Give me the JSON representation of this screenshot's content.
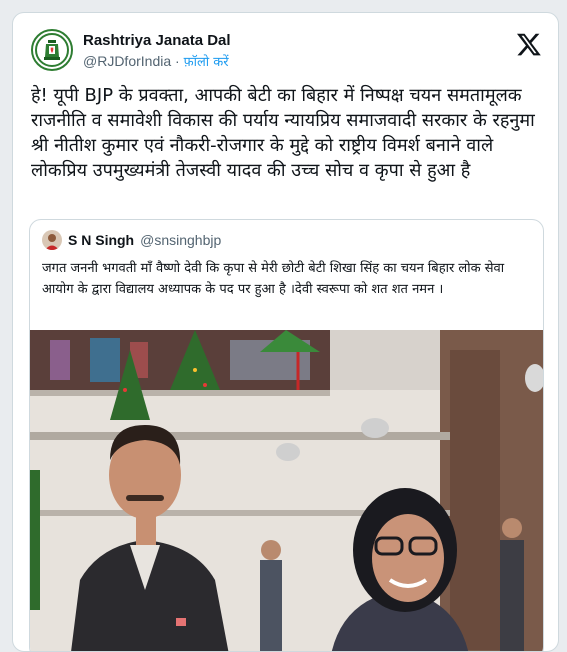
{
  "account": {
    "display_name": "Rashtriya Janata Dal",
    "handle": "@RJDforIndia",
    "separator": " · ",
    "follow_label": "फ़ॉलो करें"
  },
  "brand_icon": "x-logo-icon",
  "tweet": {
    "text": "हे! यूपी BJP के प्रवक्ता, आपकी बेटी का बिहार में निष्पक्ष चयन समतामूलक राजनीति व समावेशी विकास की पर्याय न्यायप्रिय समाजवादी सरकार के रहनुमा श्री नीतीश कुमार एवं नौकरी-रोजगार के मुद्दे को राष्ट्रीय विमर्श बनाने वाले लोकप्रिय उपमुख्यमंत्री तेजस्वी यादव की उच्च सोच व कृपा से हुआ है"
  },
  "quoted_tweet": {
    "display_name": "S N Singh",
    "handle": "@snsinghbjp",
    "text": "जगत जननी भगवती माँ वैष्णो देवी कि कृपा से मेरी छोटी बेटी शिखा सिंह का चयन बिहार लोक सेवा आयोग के द्वारा विद्यालय अध्यापक के पद पर हुआ है ।देवी स्वरूपा को शत शत नमन ।"
  },
  "colors": {
    "accent": "#1d9bf0",
    "secondary_text": "#536471",
    "border": "#cfd9de",
    "party_green": "#2e7d32"
  }
}
